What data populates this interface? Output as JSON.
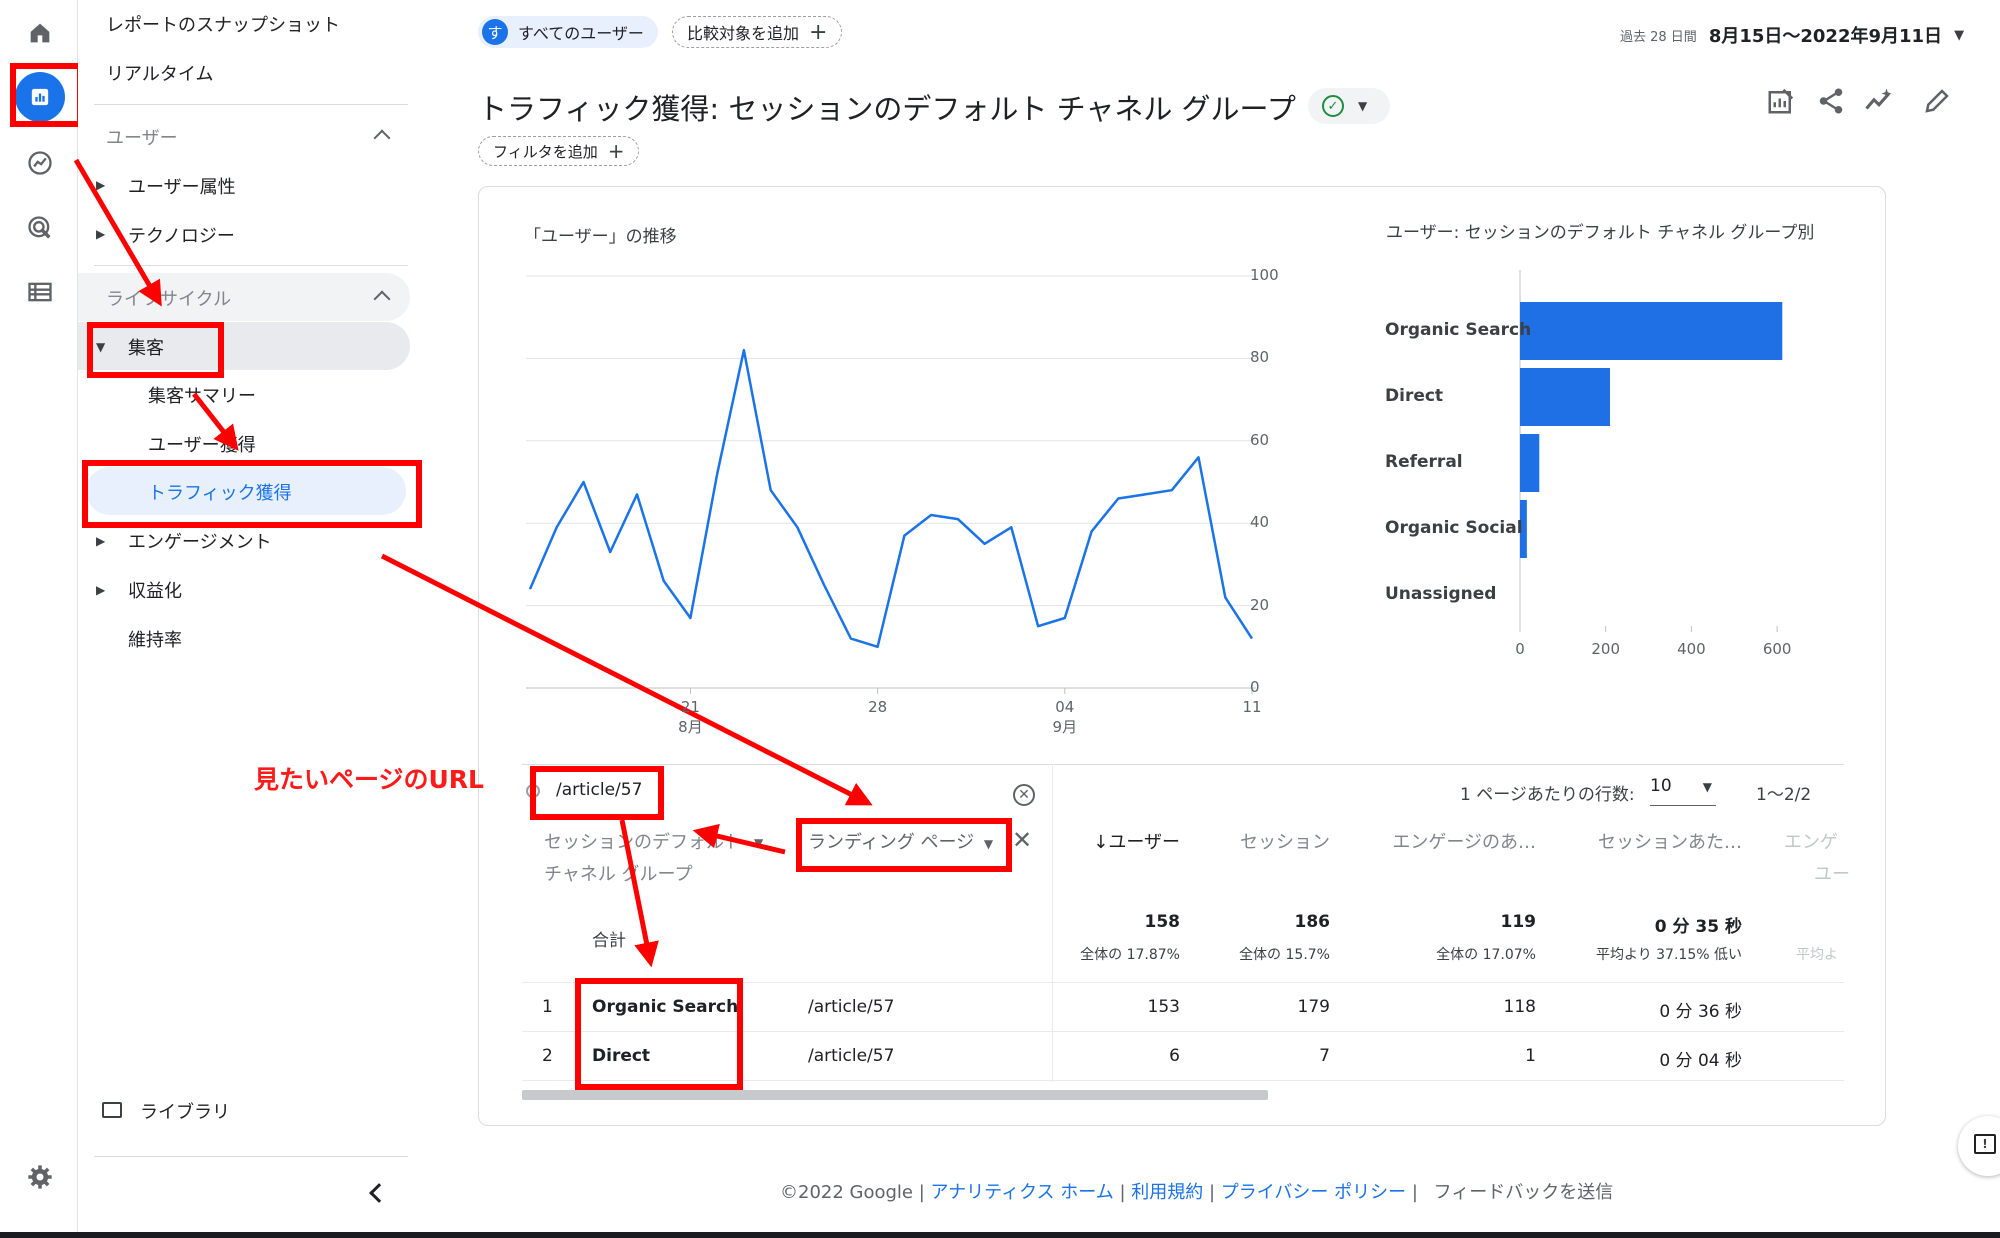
{
  "sidebar": {
    "snapshot": "レポートのスナップショット",
    "realtime": "リアルタイム",
    "section_user": "ユーザー",
    "user_attr": "ユーザー属性",
    "technology": "テクノロジー",
    "section_lifecycle": "ライフサイクル",
    "acquisition": "集客",
    "acq_summary": "集客サマリー",
    "user_acq": "ユーザー獲得",
    "traffic_acq": "トラフィック獲得",
    "engagement": "エンゲージメント",
    "monetization": "収益化",
    "retention": "維持率",
    "library": "ライブラリ"
  },
  "header": {
    "segment_avatar": "す",
    "segment": "すべてのユーザー",
    "compare": "比較対象を追加",
    "date_prefix": "過去 28 日間",
    "date_range": "8月15日〜2022年9月11日",
    "title": "トラフィック獲得: セッションのデフォルト チャネル グループ",
    "filter": "フィルタを追加"
  },
  "chart_data": [
    {
      "type": "line",
      "title": "「ユーザー」の推移",
      "x_ticks": [
        "21",
        "28",
        "04",
        "11"
      ],
      "x_tick_sub": [
        "8月",
        "",
        "9月",
        ""
      ],
      "y_ticks": [
        0,
        20,
        40,
        60,
        80,
        100
      ],
      "ylim": [
        0,
        100
      ],
      "series": [
        {
          "values": [
            24,
            39,
            50,
            33,
            47,
            26,
            17,
            52,
            82,
            48,
            39,
            25,
            12,
            10,
            37,
            42,
            41,
            35,
            39,
            15,
            17,
            38,
            46,
            47,
            48,
            56,
            22,
            12
          ]
        }
      ]
    },
    {
      "type": "bar",
      "title": "ユーザー: セッションのデフォルト チャネル グループ別",
      "categories": [
        "Organic Search",
        "Direct",
        "Referral",
        "Organic Social",
        "Unassigned"
      ],
      "values": [
        612,
        210,
        45,
        16,
        0
      ],
      "x_ticks": [
        0,
        200,
        400,
        600
      ],
      "xlim": [
        0,
        700
      ]
    }
  ],
  "table": {
    "search_value": "/article/57",
    "rows_per_page_label": "1 ページあたりの行数:",
    "rows_per_page": "10",
    "pagination": "1〜2/2",
    "dim1_line1": "セッションのデフォルト",
    "dim1_line2": "チャネル グループ",
    "dim2": "ランディング ページ",
    "col_users": "↓ユーザー",
    "col_sessions": "セッション",
    "col_engaged": "エンゲージのあ…",
    "col_per_session": "セッションあた…",
    "col_cut1": "エンゲ",
    "col_cut2": "ユー",
    "total_label": "合計",
    "total_users": "158",
    "total_users_sub": "全体の 17.87%",
    "total_sessions": "186",
    "total_sessions_sub": "全体の 15.7%",
    "total_engaged": "119",
    "total_engaged_sub": "全体の 17.07%",
    "total_per_session": "0 分 35 秒",
    "total_per_session_sub": "平均より 37.15% 低い",
    "total_cut": "平均よ",
    "rows": [
      {
        "num": "1",
        "channel": "Organic Search",
        "page": "/article/57",
        "users": "153",
        "sessions": "179",
        "engaged": "118",
        "per_session": "0 分 36 秒"
      },
      {
        "num": "2",
        "channel": "Direct",
        "page": "/article/57",
        "users": "6",
        "sessions": "7",
        "engaged": "1",
        "per_session": "0 分 04 秒"
      }
    ]
  },
  "annotation": {
    "url_label": "見たいページのURL"
  },
  "footer": {
    "copyright": "©2022 Google",
    "link_home": "アナリティクス ホーム",
    "link_terms": "利用規約",
    "link_privacy": "プライバシー ポリシー",
    "feedback": "フィードバックを送信"
  },
  "colors": {
    "accent": "#1a73e8",
    "bar": "#1f6fe5",
    "annotation": "#ff0000",
    "active_bg": "#e8f0fe"
  }
}
